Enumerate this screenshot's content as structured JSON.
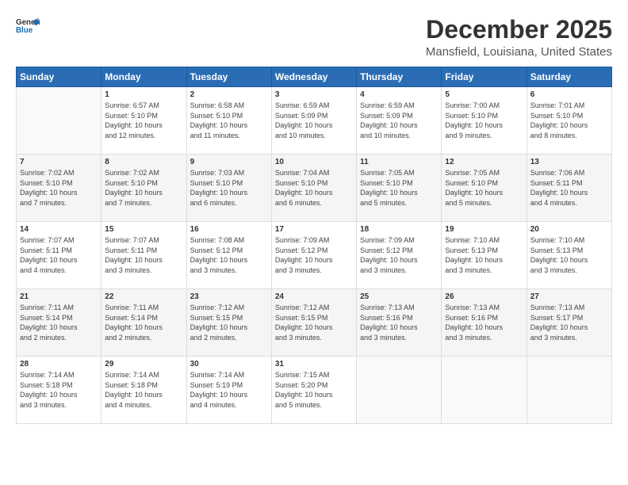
{
  "logo": {
    "line1": "General",
    "line2": "Blue"
  },
  "title": "December 2025",
  "subtitle": "Mansfield, Louisiana, United States",
  "days_of_week": [
    "Sunday",
    "Monday",
    "Tuesday",
    "Wednesday",
    "Thursday",
    "Friday",
    "Saturday"
  ],
  "weeks": [
    [
      {
        "day": "",
        "info": ""
      },
      {
        "day": "1",
        "info": "Sunrise: 6:57 AM\nSunset: 5:10 PM\nDaylight: 10 hours\nand 12 minutes."
      },
      {
        "day": "2",
        "info": "Sunrise: 6:58 AM\nSunset: 5:10 PM\nDaylight: 10 hours\nand 11 minutes."
      },
      {
        "day": "3",
        "info": "Sunrise: 6:59 AM\nSunset: 5:09 PM\nDaylight: 10 hours\nand 10 minutes."
      },
      {
        "day": "4",
        "info": "Sunrise: 6:59 AM\nSunset: 5:09 PM\nDaylight: 10 hours\nand 10 minutes."
      },
      {
        "day": "5",
        "info": "Sunrise: 7:00 AM\nSunset: 5:10 PM\nDaylight: 10 hours\nand 9 minutes."
      },
      {
        "day": "6",
        "info": "Sunrise: 7:01 AM\nSunset: 5:10 PM\nDaylight: 10 hours\nand 8 minutes."
      }
    ],
    [
      {
        "day": "7",
        "info": "Sunrise: 7:02 AM\nSunset: 5:10 PM\nDaylight: 10 hours\nand 7 minutes."
      },
      {
        "day": "8",
        "info": "Sunrise: 7:02 AM\nSunset: 5:10 PM\nDaylight: 10 hours\nand 7 minutes."
      },
      {
        "day": "9",
        "info": "Sunrise: 7:03 AM\nSunset: 5:10 PM\nDaylight: 10 hours\nand 6 minutes."
      },
      {
        "day": "10",
        "info": "Sunrise: 7:04 AM\nSunset: 5:10 PM\nDaylight: 10 hours\nand 6 minutes."
      },
      {
        "day": "11",
        "info": "Sunrise: 7:05 AM\nSunset: 5:10 PM\nDaylight: 10 hours\nand 5 minutes."
      },
      {
        "day": "12",
        "info": "Sunrise: 7:05 AM\nSunset: 5:10 PM\nDaylight: 10 hours\nand 5 minutes."
      },
      {
        "day": "13",
        "info": "Sunrise: 7:06 AM\nSunset: 5:11 PM\nDaylight: 10 hours\nand 4 minutes."
      }
    ],
    [
      {
        "day": "14",
        "info": "Sunrise: 7:07 AM\nSunset: 5:11 PM\nDaylight: 10 hours\nand 4 minutes."
      },
      {
        "day": "15",
        "info": "Sunrise: 7:07 AM\nSunset: 5:11 PM\nDaylight: 10 hours\nand 3 minutes."
      },
      {
        "day": "16",
        "info": "Sunrise: 7:08 AM\nSunset: 5:12 PM\nDaylight: 10 hours\nand 3 minutes."
      },
      {
        "day": "17",
        "info": "Sunrise: 7:09 AM\nSunset: 5:12 PM\nDaylight: 10 hours\nand 3 minutes."
      },
      {
        "day": "18",
        "info": "Sunrise: 7:09 AM\nSunset: 5:12 PM\nDaylight: 10 hours\nand 3 minutes."
      },
      {
        "day": "19",
        "info": "Sunrise: 7:10 AM\nSunset: 5:13 PM\nDaylight: 10 hours\nand 3 minutes."
      },
      {
        "day": "20",
        "info": "Sunrise: 7:10 AM\nSunset: 5:13 PM\nDaylight: 10 hours\nand 3 minutes."
      }
    ],
    [
      {
        "day": "21",
        "info": "Sunrise: 7:11 AM\nSunset: 5:14 PM\nDaylight: 10 hours\nand 2 minutes."
      },
      {
        "day": "22",
        "info": "Sunrise: 7:11 AM\nSunset: 5:14 PM\nDaylight: 10 hours\nand 2 minutes."
      },
      {
        "day": "23",
        "info": "Sunrise: 7:12 AM\nSunset: 5:15 PM\nDaylight: 10 hours\nand 2 minutes."
      },
      {
        "day": "24",
        "info": "Sunrise: 7:12 AM\nSunset: 5:15 PM\nDaylight: 10 hours\nand 3 minutes."
      },
      {
        "day": "25",
        "info": "Sunrise: 7:13 AM\nSunset: 5:16 PM\nDaylight: 10 hours\nand 3 minutes."
      },
      {
        "day": "26",
        "info": "Sunrise: 7:13 AM\nSunset: 5:16 PM\nDaylight: 10 hours\nand 3 minutes."
      },
      {
        "day": "27",
        "info": "Sunrise: 7:13 AM\nSunset: 5:17 PM\nDaylight: 10 hours\nand 3 minutes."
      }
    ],
    [
      {
        "day": "28",
        "info": "Sunrise: 7:14 AM\nSunset: 5:18 PM\nDaylight: 10 hours\nand 3 minutes."
      },
      {
        "day": "29",
        "info": "Sunrise: 7:14 AM\nSunset: 5:18 PM\nDaylight: 10 hours\nand 4 minutes."
      },
      {
        "day": "30",
        "info": "Sunrise: 7:14 AM\nSunset: 5:19 PM\nDaylight: 10 hours\nand 4 minutes."
      },
      {
        "day": "31",
        "info": "Sunrise: 7:15 AM\nSunset: 5:20 PM\nDaylight: 10 hours\nand 5 minutes."
      },
      {
        "day": "",
        "info": ""
      },
      {
        "day": "",
        "info": ""
      },
      {
        "day": "",
        "info": ""
      }
    ]
  ]
}
